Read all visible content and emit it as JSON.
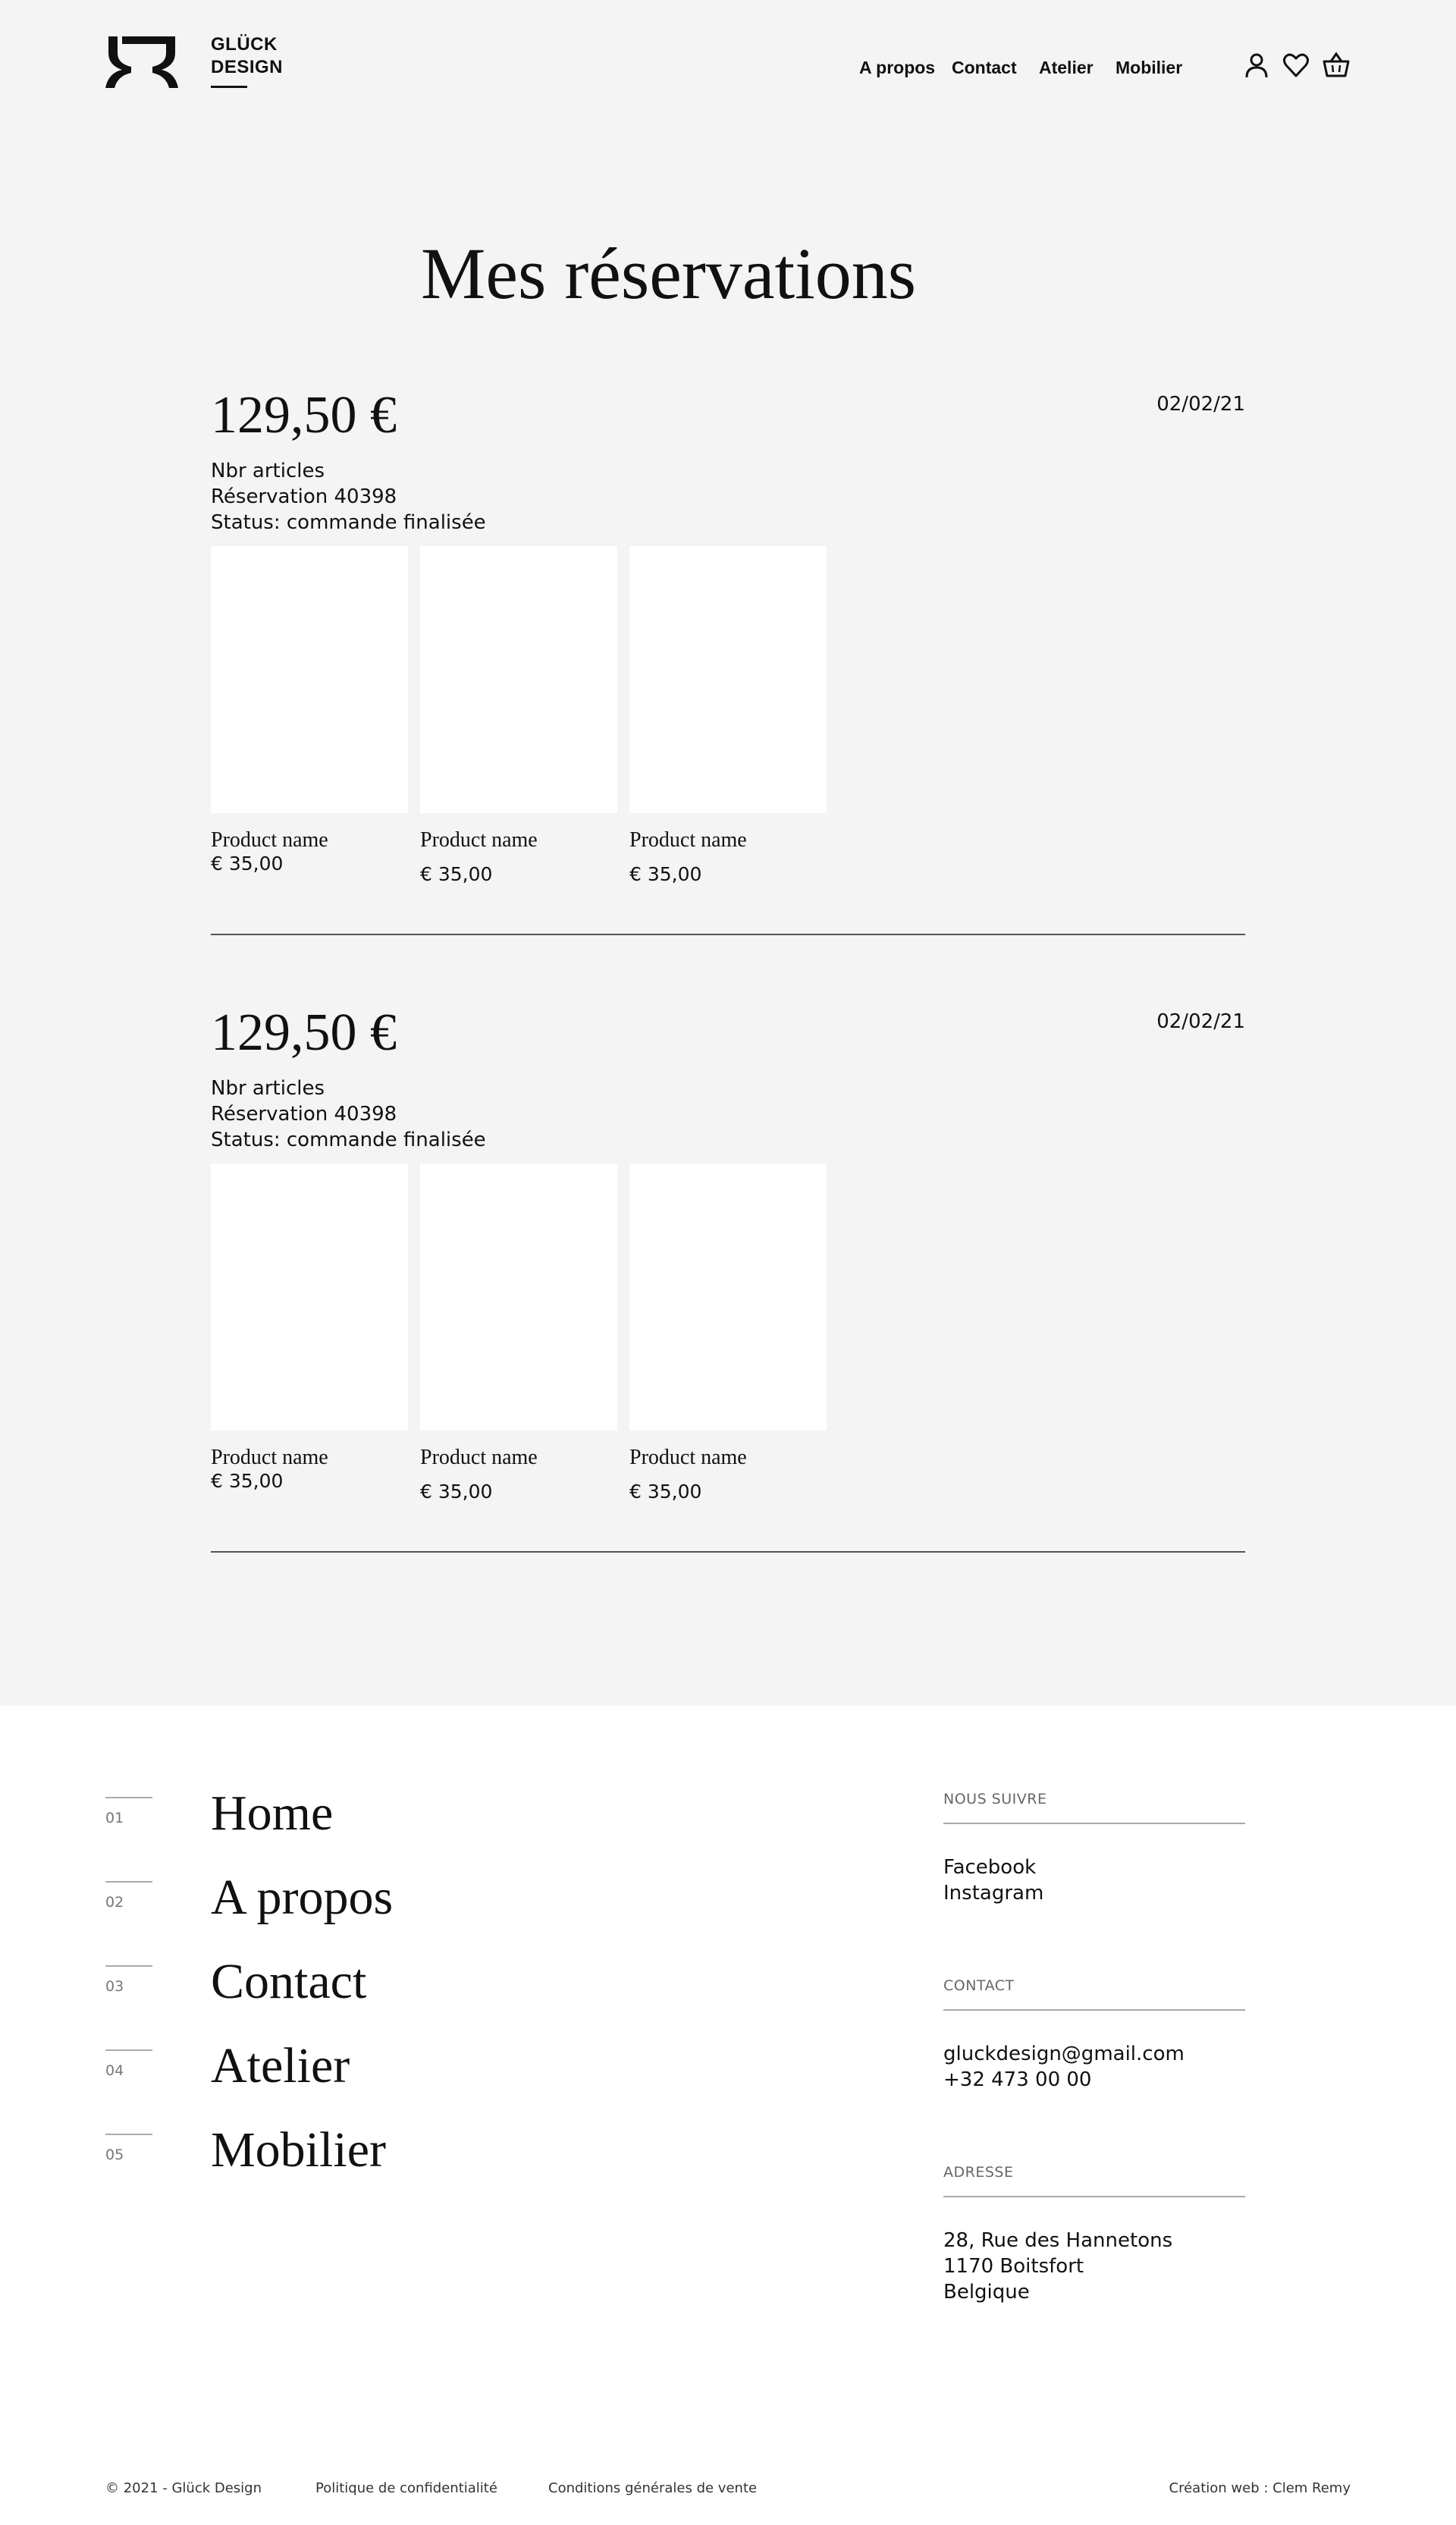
{
  "brand": {
    "line1": "GLÜCK",
    "line2": "DESIGN"
  },
  "nav": {
    "items": [
      "A propos",
      "Contact",
      "Atelier",
      "Mobilier"
    ]
  },
  "header_icons": [
    "user-icon",
    "heart-icon",
    "basket-icon"
  ],
  "page_title": "Mes réservations",
  "orders": [
    {
      "total": "129,50 €",
      "date": "02/02/21",
      "count_label": "Nbr articles",
      "reservation": "Réservation 40398",
      "status": "Status: commande finalisée",
      "products": [
        {
          "name": "Product name",
          "price": "€ 35,00"
        },
        {
          "name": "Product name",
          "price": "€ 35,00"
        },
        {
          "name": "Product name",
          "price": "€ 35,00"
        }
      ]
    },
    {
      "total": "129,50 €",
      "date": "02/02/21",
      "count_label": "Nbr articles",
      "reservation": "Réservation 40398",
      "status": "Status: commande finalisée",
      "products": [
        {
          "name": "Product name",
          "price": "€ 35,00"
        },
        {
          "name": "Product name",
          "price": "€ 35,00"
        },
        {
          "name": "Product name",
          "price": "€ 35,00"
        }
      ]
    }
  ],
  "footer": {
    "nav": [
      {
        "num": "01",
        "label": "Home"
      },
      {
        "num": "02",
        "label": "A propos"
      },
      {
        "num": "03",
        "label": "Contact"
      },
      {
        "num": "04",
        "label": "Atelier"
      },
      {
        "num": "05",
        "label": "Mobilier"
      }
    ],
    "follow": {
      "title": "NOUS SUIVRE",
      "items": [
        "Facebook",
        "Instagram"
      ]
    },
    "contact": {
      "title": "CONTACT",
      "items": [
        "gluckdesign@gmail.com",
        "+32 473 00 00"
      ]
    },
    "address": {
      "title": "ADRESSE",
      "items": [
        "28, Rue des Hannetons",
        "1170 Boitsfort",
        "Belgique"
      ]
    },
    "copyright": "© 2021 - Glück Design",
    "privacy": "Politique de confidentialité",
    "terms": "Conditions générales de vente",
    "credit": "Création web : Clem Remy"
  }
}
